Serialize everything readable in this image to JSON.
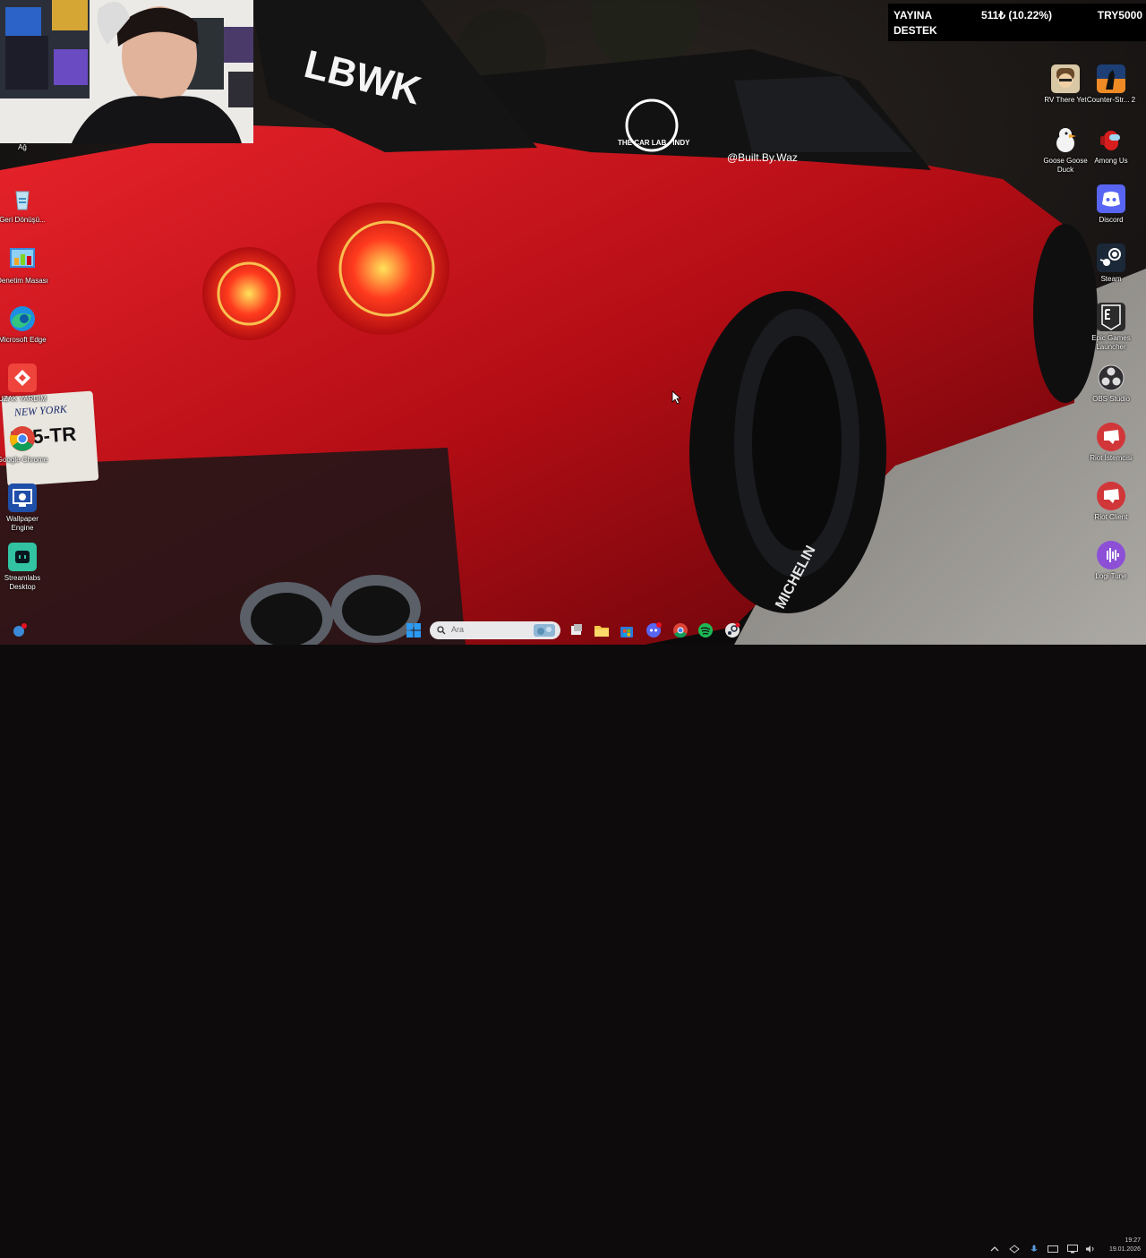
{
  "overlay": {
    "line1": "YAYINA",
    "line2": "DESTEK",
    "amount": "511₺ (10.22%)",
    "goal": "TRY5000",
    "progress_percent": 10.22
  },
  "desktop_left": [
    {
      "label": "Ağ",
      "icon": "network-icon"
    },
    {
      "label": "Geri Dönüşü...",
      "icon": "recycle-bin-icon"
    },
    {
      "label": "Denetim Masası",
      "icon": "control-panel-icon"
    },
    {
      "label": "Microsoft Edge",
      "icon": "edge-icon"
    },
    {
      "label": "UZAK YARDIM",
      "icon": "anydesk-icon"
    },
    {
      "label": "Google Chrome",
      "icon": "chrome-icon"
    },
    {
      "label": "Wallpaper Engine",
      "icon": "wallpaper-engine-icon"
    },
    {
      "label": "Streamlabs Desktop",
      "icon": "streamlabs-icon"
    }
  ],
  "desktop_right": [
    {
      "label": "RV There Yet",
      "icon": "rv-there-yet-icon"
    },
    {
      "label": "Counter-Str... 2",
      "icon": "counter-strike-icon"
    },
    {
      "label": "Goose Goose Duck",
      "icon": "goose-goose-duck-icon"
    },
    {
      "label": "Among Us",
      "icon": "among-us-icon"
    },
    {
      "label": "Discord",
      "icon": "discord-icon"
    },
    {
      "label": "Steam",
      "icon": "steam-icon"
    },
    {
      "label": "Epic Games Launcher",
      "icon": "epic-games-icon"
    },
    {
      "label": "OBS Studio",
      "icon": "obs-icon"
    },
    {
      "label": "Riot İstemcisi",
      "icon": "riot-client-icon"
    },
    {
      "label": "Riot Client",
      "icon": "riot-client-icon"
    },
    {
      "label": "Logi Tune",
      "icon": "logi-tune-icon"
    }
  ],
  "wallpaper_text": {
    "wing_brand": "LBWK",
    "sticker_line1": "THE CAR LAB - INDY",
    "sticker_handle": "@Built.By.Waz",
    "plate_state": "NEW YORK",
    "plate_number": "755-TR",
    "tire_brand": "MICHELIN"
  },
  "taskbar": {
    "search_placeholder": "Ara",
    "clock_time": "19:27",
    "clock_date": "19.01.2026"
  },
  "colors": {
    "accent_red": "#d2141a",
    "overlay_bg": "#000000",
    "windows_blue": "#1e90ff"
  }
}
